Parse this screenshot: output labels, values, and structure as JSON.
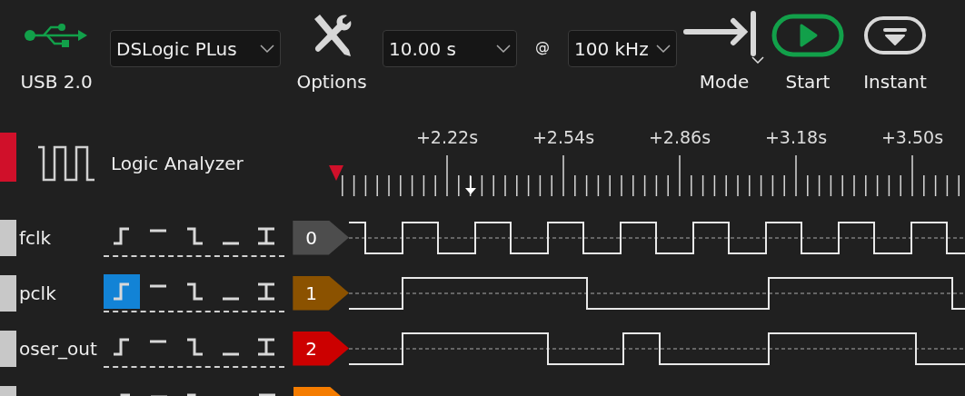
{
  "toolbar": {
    "items": [
      {
        "kind": "usb",
        "label": "USB 2.0"
      },
      {
        "kind": "select",
        "value": "DSLogic PLus"
      },
      {
        "kind": "options",
        "label": "Options"
      },
      {
        "kind": "select",
        "value": "10.00 s"
      },
      {
        "kind": "text",
        "text": "@"
      },
      {
        "kind": "select",
        "value": "100 kHz"
      },
      {
        "kind": "mode",
        "label": "Mode"
      },
      {
        "kind": "start",
        "label": "Start"
      },
      {
        "kind": "instant",
        "label": "Instant"
      }
    ]
  },
  "panel": {
    "title": "Logic Analyzer"
  },
  "ruler": {
    "labels": [
      "+2.22s",
      "+2.54s",
      "+2.86s",
      "+3.18s",
      "+3.50s"
    ]
  },
  "channels": [
    {
      "name": "fclk",
      "number": "0",
      "color": "#4d4d4d",
      "triggers": [
        {
          "kind": "rising",
          "selected": false
        },
        {
          "kind": "high",
          "selected": false
        },
        {
          "kind": "falling",
          "selected": false
        },
        {
          "kind": "low",
          "selected": false
        },
        {
          "kind": "edge",
          "selected": false
        }
      ]
    },
    {
      "name": "pclk",
      "number": "1",
      "color": "#8b5200",
      "triggers": [
        {
          "kind": "rising",
          "selected": true
        },
        {
          "kind": "high",
          "selected": false
        },
        {
          "kind": "falling",
          "selected": false
        },
        {
          "kind": "low",
          "selected": false
        },
        {
          "kind": "edge",
          "selected": false
        }
      ]
    },
    {
      "name": "oser_out",
      "number": "2",
      "color": "#cc0000",
      "triggers": [
        {
          "kind": "rising",
          "selected": false
        },
        {
          "kind": "high",
          "selected": false
        },
        {
          "kind": "falling",
          "selected": false
        },
        {
          "kind": "low",
          "selected": false
        },
        {
          "kind": "edge",
          "selected": false
        }
      ]
    },
    {
      "color": "#f57c00",
      "triggers": [
        {
          "kind": "rising",
          "selected": false
        },
        {
          "kind": "high",
          "selected": false
        },
        {
          "kind": "falling",
          "selected": false
        },
        {
          "kind": "edge",
          "selected": false
        }
      ]
    }
  ]
}
